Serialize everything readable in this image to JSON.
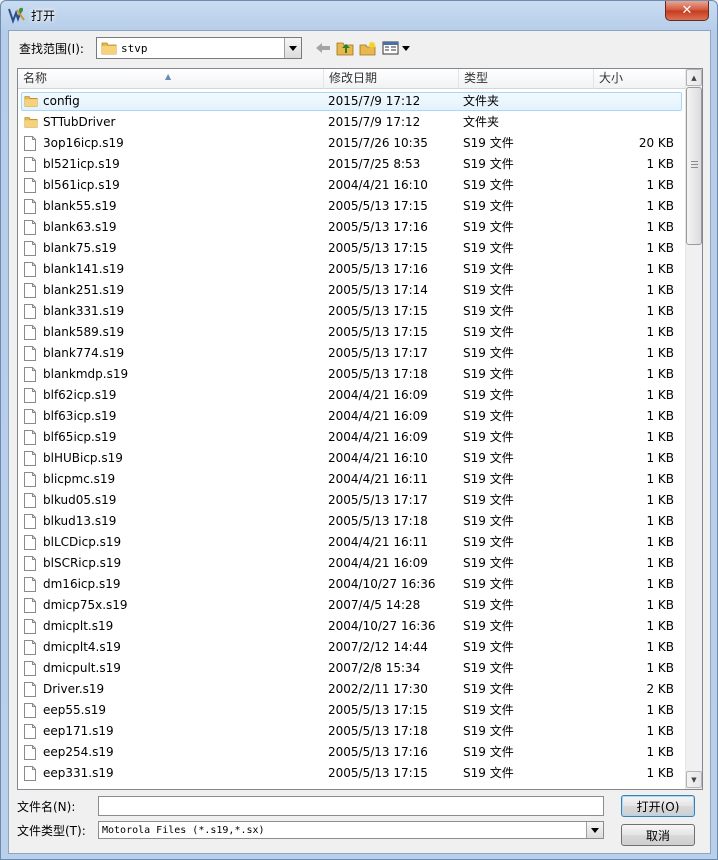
{
  "window": {
    "title": "打开",
    "close_glyph": "✕"
  },
  "lookin": {
    "label": "查找范围(I):",
    "value": "stvp"
  },
  "columns": {
    "name": "名称",
    "date": "修改日期",
    "type": "类型",
    "size": "大小"
  },
  "files": [
    {
      "name": "config",
      "date": "2015/7/9 17:12",
      "type": "文件夹",
      "size": "",
      "kind": "folder"
    },
    {
      "name": "STTubDriver",
      "date": "2015/7/9 17:12",
      "type": "文件夹",
      "size": "",
      "kind": "folder"
    },
    {
      "name": "3op16icp.s19",
      "date": "2015/7/26 10:35",
      "type": "S19 文件",
      "size": "20 KB",
      "kind": "file"
    },
    {
      "name": "bl521icp.s19",
      "date": "2015/7/25 8:53",
      "type": "S19 文件",
      "size": "1 KB",
      "kind": "file"
    },
    {
      "name": "bl561icp.s19",
      "date": "2004/4/21 16:10",
      "type": "S19 文件",
      "size": "1 KB",
      "kind": "file"
    },
    {
      "name": "blank55.s19",
      "date": "2005/5/13 17:15",
      "type": "S19 文件",
      "size": "1 KB",
      "kind": "file"
    },
    {
      "name": "blank63.s19",
      "date": "2005/5/13 17:16",
      "type": "S19 文件",
      "size": "1 KB",
      "kind": "file"
    },
    {
      "name": "blank75.s19",
      "date": "2005/5/13 17:15",
      "type": "S19 文件",
      "size": "1 KB",
      "kind": "file"
    },
    {
      "name": "blank141.s19",
      "date": "2005/5/13 17:16",
      "type": "S19 文件",
      "size": "1 KB",
      "kind": "file"
    },
    {
      "name": "blank251.s19",
      "date": "2005/5/13 17:14",
      "type": "S19 文件",
      "size": "1 KB",
      "kind": "file"
    },
    {
      "name": "blank331.s19",
      "date": "2005/5/13 17:15",
      "type": "S19 文件",
      "size": "1 KB",
      "kind": "file"
    },
    {
      "name": "blank589.s19",
      "date": "2005/5/13 17:15",
      "type": "S19 文件",
      "size": "1 KB",
      "kind": "file"
    },
    {
      "name": "blank774.s19",
      "date": "2005/5/13 17:17",
      "type": "S19 文件",
      "size": "1 KB",
      "kind": "file"
    },
    {
      "name": "blankmdp.s19",
      "date": "2005/5/13 17:18",
      "type": "S19 文件",
      "size": "1 KB",
      "kind": "file"
    },
    {
      "name": "blf62icp.s19",
      "date": "2004/4/21 16:09",
      "type": "S19 文件",
      "size": "1 KB",
      "kind": "file"
    },
    {
      "name": "blf63icp.s19",
      "date": "2004/4/21 16:09",
      "type": "S19 文件",
      "size": "1 KB",
      "kind": "file"
    },
    {
      "name": "blf65icp.s19",
      "date": "2004/4/21 16:09",
      "type": "S19 文件",
      "size": "1 KB",
      "kind": "file"
    },
    {
      "name": "blHUBicp.s19",
      "date": "2004/4/21 16:10",
      "type": "S19 文件",
      "size": "1 KB",
      "kind": "file"
    },
    {
      "name": "blicpmc.s19",
      "date": "2004/4/21 16:11",
      "type": "S19 文件",
      "size": "1 KB",
      "kind": "file"
    },
    {
      "name": "blkud05.s19",
      "date": "2005/5/13 17:17",
      "type": "S19 文件",
      "size": "1 KB",
      "kind": "file"
    },
    {
      "name": "blkud13.s19",
      "date": "2005/5/13 17:18",
      "type": "S19 文件",
      "size": "1 KB",
      "kind": "file"
    },
    {
      "name": "blLCDicp.s19",
      "date": "2004/4/21 16:11",
      "type": "S19 文件",
      "size": "1 KB",
      "kind": "file"
    },
    {
      "name": "blSCRicp.s19",
      "date": "2004/4/21 16:09",
      "type": "S19 文件",
      "size": "1 KB",
      "kind": "file"
    },
    {
      "name": "dm16icp.s19",
      "date": "2004/10/27 16:36",
      "type": "S19 文件",
      "size": "1 KB",
      "kind": "file"
    },
    {
      "name": "dmicp75x.s19",
      "date": "2007/4/5 14:28",
      "type": "S19 文件",
      "size": "1 KB",
      "kind": "file"
    },
    {
      "name": "dmicplt.s19",
      "date": "2004/10/27 16:36",
      "type": "S19 文件",
      "size": "1 KB",
      "kind": "file"
    },
    {
      "name": "dmicplt4.s19",
      "date": "2007/2/12 14:44",
      "type": "S19 文件",
      "size": "1 KB",
      "kind": "file"
    },
    {
      "name": "dmicpult.s19",
      "date": "2007/2/8 15:34",
      "type": "S19 文件",
      "size": "1 KB",
      "kind": "file"
    },
    {
      "name": "Driver.s19",
      "date": "2002/2/11 17:30",
      "type": "S19 文件",
      "size": "2 KB",
      "kind": "file"
    },
    {
      "name": "eep55.s19",
      "date": "2005/5/13 17:15",
      "type": "S19 文件",
      "size": "1 KB",
      "kind": "file"
    },
    {
      "name": "eep171.s19",
      "date": "2005/5/13 17:18",
      "type": "S19 文件",
      "size": "1 KB",
      "kind": "file"
    },
    {
      "name": "eep254.s19",
      "date": "2005/5/13 17:16",
      "type": "S19 文件",
      "size": "1 KB",
      "kind": "file"
    },
    {
      "name": "eep331.s19",
      "date": "2005/5/13 17:15",
      "type": "S19 文件",
      "size": "1 KB",
      "kind": "file"
    }
  ],
  "filename": {
    "label": "文件名(N):",
    "value": ""
  },
  "filetype": {
    "label": "文件类型(T):",
    "value": "Motorola Files (*.s19,*.sx)"
  },
  "buttons": {
    "open": "打开(O)",
    "cancel": "取消"
  },
  "icons": {
    "app": "stvp-app-icon",
    "close": "close-icon",
    "back": "back-arrow-icon",
    "up": "up-folder-icon",
    "newfolder": "new-folder-icon",
    "view": "view-menu-icon",
    "folder": "folder-icon",
    "file": "file-icon"
  },
  "colors": {
    "selection": "#e3f2fc",
    "selection_border": "#a8d8f7",
    "close": "#c63a1c"
  }
}
